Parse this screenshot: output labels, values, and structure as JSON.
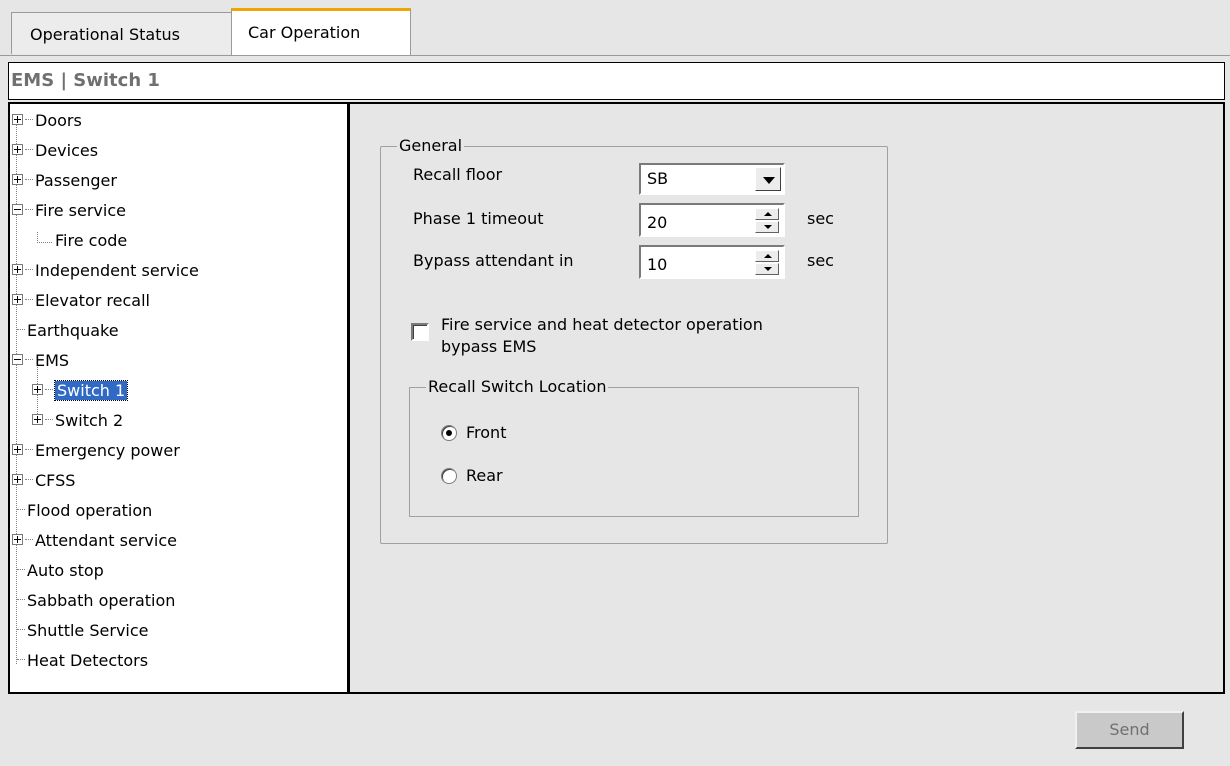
{
  "tabs": [
    {
      "label": "Operational Status",
      "active": false
    },
    {
      "label": "Car Operation",
      "active": true
    }
  ],
  "header": {
    "title": "EMS | Switch 1"
  },
  "tree": {
    "items": [
      {
        "label": "Doors",
        "expander": "plus"
      },
      {
        "label": "Devices",
        "expander": "plus"
      },
      {
        "label": "Passenger",
        "expander": "plus"
      },
      {
        "label": "Fire service",
        "expander": "minus"
      },
      {
        "label": "Fire code",
        "expander": "leaf-child"
      },
      {
        "label": "Independent service",
        "expander": "plus"
      },
      {
        "label": "Elevator recall",
        "expander": "plus"
      },
      {
        "label": "Earthquake",
        "expander": "none"
      },
      {
        "label": "EMS",
        "expander": "minus"
      },
      {
        "label": "Switch 1",
        "expander": "plus",
        "selected": true
      },
      {
        "label": "Switch 2",
        "expander": "plus"
      },
      {
        "label": "Emergency power",
        "expander": "plus"
      },
      {
        "label": "CFSS",
        "expander": "plus"
      },
      {
        "label": "Flood operation",
        "expander": "none"
      },
      {
        "label": "Attendant service",
        "expander": "plus"
      },
      {
        "label": "Auto stop",
        "expander": "none"
      },
      {
        "label": "Sabbath operation",
        "expander": "none"
      },
      {
        "label": "Shuttle Service",
        "expander": "none"
      },
      {
        "label": "Heat Detectors",
        "expander": "none"
      }
    ]
  },
  "general": {
    "legend": "General",
    "recall_floor_label": "Recall floor",
    "recall_floor_value": "SB",
    "phase1_label": "Phase 1 timeout",
    "phase1_value": "20",
    "phase1_unit": "sec",
    "bypass_label": "Bypass attendant in",
    "bypass_value": "10",
    "bypass_unit": "sec",
    "checkbox_line1": "Fire service and heat detector operation",
    "checkbox_line2": "bypass EMS",
    "checkbox_checked": false
  },
  "recall_location": {
    "legend": "Recall Switch Location",
    "front_label": "Front",
    "rear_label": "Rear",
    "selected": "Front"
  },
  "send_label": "Send"
}
